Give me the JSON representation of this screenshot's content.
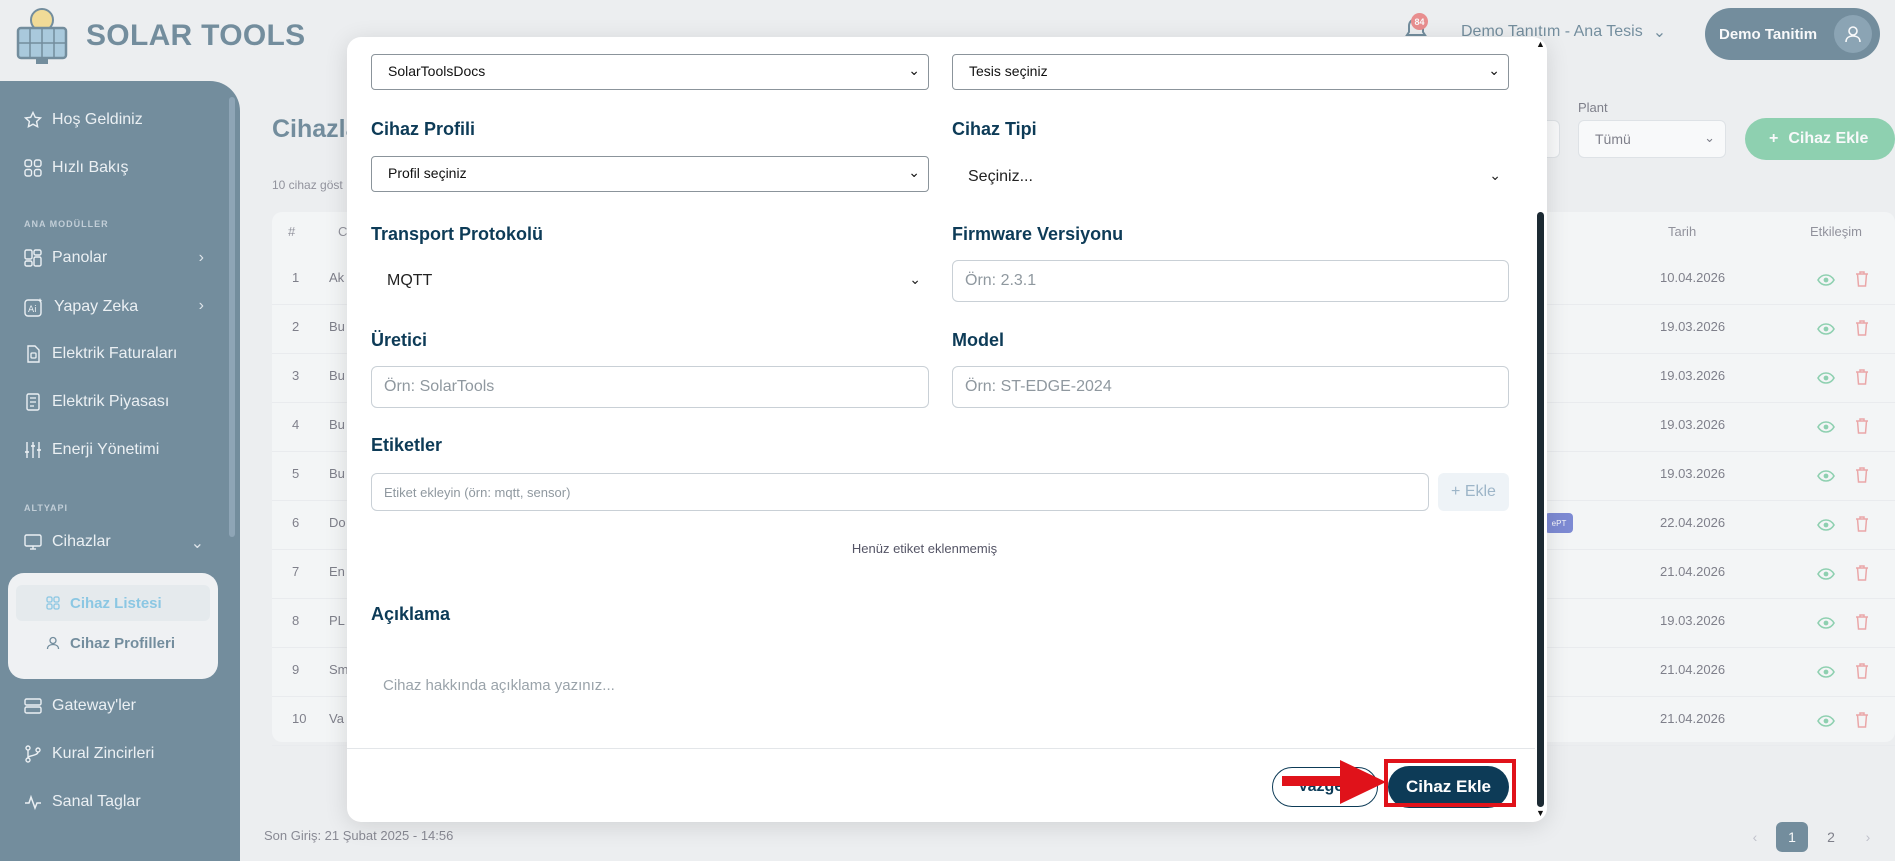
{
  "header": {
    "brand": "SOLAR TOOLS",
    "notification_count": "84",
    "tenant": "Demo Tanıtım - Ana Tesis",
    "user": "Demo Tanitim"
  },
  "sidebar": {
    "items_top": [
      {
        "label": "Hoş Geldiniz",
        "icon": "star-icon"
      },
      {
        "label": "Hızlı Bakış",
        "icon": "grid-icon"
      }
    ],
    "section_main": "ANA MODÜLLER",
    "items_main": [
      {
        "label": "Panolar",
        "icon": "dashboard-icon"
      },
      {
        "label": "Yapay Zeka",
        "icon": "ai-icon"
      },
      {
        "label": "Elektrik Faturaları",
        "icon": "invoice-icon"
      },
      {
        "label": "Elektrik Piyasası",
        "icon": "market-icon"
      },
      {
        "label": "Enerji Yönetimi",
        "icon": "sliders-icon"
      }
    ],
    "section_infra": "ALTYAPI",
    "devices": "Cihazlar",
    "sub_items": [
      {
        "label": "Cihaz Listesi",
        "icon": "grid-icon"
      },
      {
        "label": "Cihaz Profilleri",
        "icon": "user-icon"
      }
    ],
    "items_bottom": [
      {
        "label": "Gateway'ler",
        "icon": "server-icon"
      },
      {
        "label": "Kural Zincirleri",
        "icon": "branch-icon"
      },
      {
        "label": "Sanal Taglar",
        "icon": "pulse-icon"
      }
    ]
  },
  "page": {
    "title": "Cihazla",
    "count_text": "10 cihaz göst",
    "plant_label": "Plant",
    "plant_value": "Tümü",
    "add_button": "Cihaz Ekle",
    "table_headers": {
      "index": "#",
      "name": "C",
      "date": "Tarih",
      "actions": "Etkileşim"
    },
    "rows": [
      {
        "n": "1",
        "name": "Ak",
        "date": "10.04.2026"
      },
      {
        "n": "2",
        "name": "Bu",
        "date": "19.03.2026"
      },
      {
        "n": "3",
        "name": "Bu",
        "date": "19.03.2026"
      },
      {
        "n": "4",
        "name": "Bu",
        "date": "19.03.2026"
      },
      {
        "n": "5",
        "name": "Bu",
        "date": "19.03.2026"
      },
      {
        "n": "6",
        "name": "Do",
        "date": "22.04.2026"
      },
      {
        "n": "7",
        "name": "En",
        "date": "21.04.2026"
      },
      {
        "n": "8",
        "name": "PL",
        "date": "19.03.2026"
      },
      {
        "n": "9",
        "name": "Sm",
        "date": "21.04.2026"
      },
      {
        "n": "10",
        "name": "Va",
        "date": "21.04.2026"
      }
    ],
    "chip_text": "ePT",
    "last_login": "Son Giriş: 21 Şubat 2025 - 14:56",
    "pages": [
      "1",
      "2"
    ]
  },
  "modal": {
    "workspace_value": "SolarToolsDocs",
    "plant_value": "Tesis seçiniz",
    "profile_label": "Cihaz Profili",
    "profile_value": "Profil seçiniz",
    "type_label": "Cihaz Tipi",
    "type_value": "Seçiniz...",
    "transport_label": "Transport Protokolü",
    "transport_value": "MQTT",
    "firmware_label": "Firmware Versiyonu",
    "firmware_placeholder": "Örn: 2.3.1",
    "manufacturer_label": "Üretici",
    "manufacturer_placeholder": "Örn: SolarTools",
    "model_label": "Model",
    "model_placeholder": "Örn: ST-EDGE-2024",
    "tags_label": "Etiketler",
    "tags_placeholder": "Etiket ekleyin (örn: mqtt, sensor)",
    "tags_add": "+ Ekle",
    "tags_empty": "Henüz etiket eklenmemiş",
    "description_label": "Açıklama",
    "description_placeholder": "Cihaz hakkında açıklama yazınız...",
    "cancel": "Vazgeç",
    "submit": "Cihaz Ekle"
  },
  "colors": {
    "primary": "#0d3b57",
    "accent": "#3fb579",
    "highlight": "#e0121a"
  }
}
